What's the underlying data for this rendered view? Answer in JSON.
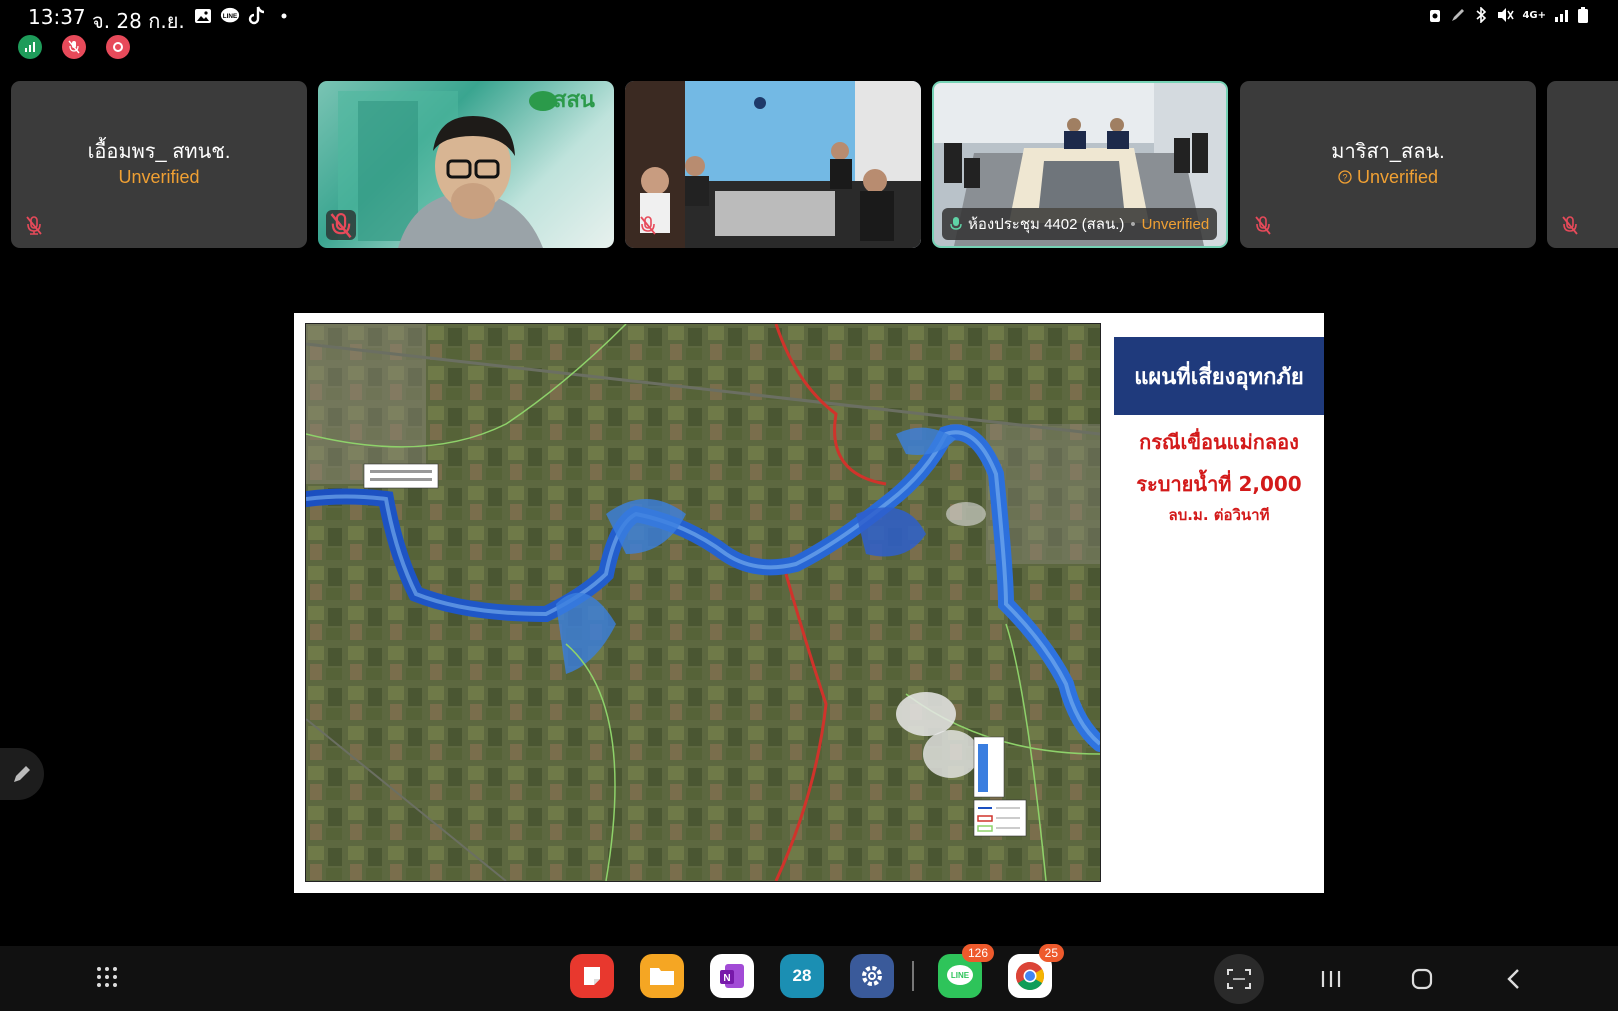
{
  "status": {
    "time": "13:37",
    "date": "จ. 28 ก.ย.",
    "left_icons": [
      "gallery-icon",
      "line-icon",
      "tiktok-icon",
      "dot-icon"
    ],
    "right_icons": [
      "alarm-icon",
      "pen-icon",
      "bluetooth-icon",
      "mute-icon",
      "network-4g-icon",
      "signal-icon",
      "battery-icon"
    ],
    "network_label": "4G+"
  },
  "meeting_indicators": [
    {
      "name": "stats-icon",
      "color": "#1e9c5a"
    },
    {
      "name": "mic-muted-icon",
      "color": "#e74a5a"
    },
    {
      "name": "record-icon",
      "color": "#e74a5a"
    }
  ],
  "participants": [
    {
      "name": "เอื้อมพร_ สทนช.",
      "status": "Unverified",
      "type": "avatar"
    },
    {
      "name": "",
      "status": "",
      "type": "video-person"
    },
    {
      "name": "",
      "status": "",
      "type": "video-room"
    },
    {
      "name": "ห้องประชุม 4402 (สลน.)",
      "status": "Unverified",
      "type": "video-conference"
    },
    {
      "name": "มาริสา_สลน.",
      "status": "Unverified",
      "type": "avatar"
    }
  ],
  "slide": {
    "title": "แผนที่เสี่ยงอุทกภัย",
    "line1": "กรณีเขื่อนแม่กลอง",
    "line2": "ระบายน้ำที่ 2,000",
    "line3": "ลบ.ม. ต่อวินาที",
    "colors": {
      "title_bg": "#1f3a7c",
      "accent": "#d31a1a"
    }
  },
  "dock": {
    "apps": [
      {
        "name": "samsung-notes-app",
        "color": "#e8382e",
        "badge": ""
      },
      {
        "name": "my-files-app",
        "color": "#f5a623",
        "badge": ""
      },
      {
        "name": "onenote-app",
        "color": "#ffffff",
        "badge": ""
      },
      {
        "name": "calendar-app",
        "color": "#1b8fb3",
        "badge": "",
        "label": "28"
      },
      {
        "name": "settings-app",
        "color": "#3a5a9a",
        "badge": ""
      },
      {
        "name": "line-app",
        "color": "#2ec45a",
        "badge": "126"
      },
      {
        "name": "chrome-app",
        "color": "#ffffff",
        "badge": "25"
      }
    ]
  }
}
